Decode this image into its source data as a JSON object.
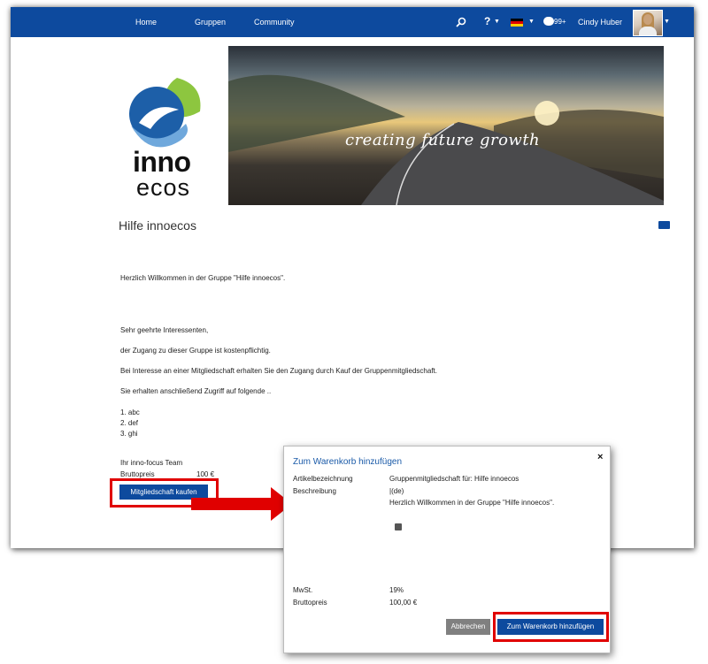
{
  "nav": {
    "home": "Home",
    "groups": "Gruppen",
    "community": "Community",
    "notifications_count": "99+",
    "user_name": "Cindy Huber",
    "icons": [
      "search-icon",
      "help-icon",
      "flag-de-icon",
      "chat-bubble-icon",
      "chevron-down-icon"
    ]
  },
  "logo": {
    "line1": "inno",
    "line2": "ecos"
  },
  "banner": {
    "tagline": "creating future growth"
  },
  "page": {
    "title": "Hilfe innoecos",
    "welcome": "Herzlich Willkommen in der Gruppe \"Hilfe innoecos\".",
    "salutation": "Sehr geehrte Interessenten,",
    "p1": "der Zugang zu dieser Gruppe ist kostenpflichtig.",
    "p2": "Bei Interesse an einer Mitgliedschaft erhalten Sie den Zugang durch Kauf der Gruppenmitgliedschaft.",
    "p3": "Sie erhalten anschließend Zugriff auf folgende ..",
    "list": [
      "1. abc",
      "2. def",
      "3. ghi"
    ],
    "signature": "Ihr inno-focus Team",
    "price_label": "Bruttopreis",
    "price_value": "100 €",
    "buy_button": "Mitgliedschaft kaufen"
  },
  "modal": {
    "title": "Zum Warenkorb hinzufügen",
    "close": "×",
    "article_label": "Artikelbezeichnung",
    "article_value": "Gruppenmitgliedschaft für: Hilfe innoecos",
    "description_label": "Beschreibung",
    "description_lang": "|(de)",
    "description_text": "Herzlich Willkommen in der Gruppe \"Hilfe innoecos\".",
    "vat_label": "MwSt.",
    "vat_value": "19%",
    "gross_label": "Bruttopreis",
    "gross_value": "100,00 €",
    "cancel_button": "Abbrechen",
    "add_button": "Zum Warenkorb hinzufügen"
  },
  "colors": {
    "brand_blue": "#0d4a9e",
    "highlight_red": "#e00000",
    "cancel_gray": "#808080"
  }
}
